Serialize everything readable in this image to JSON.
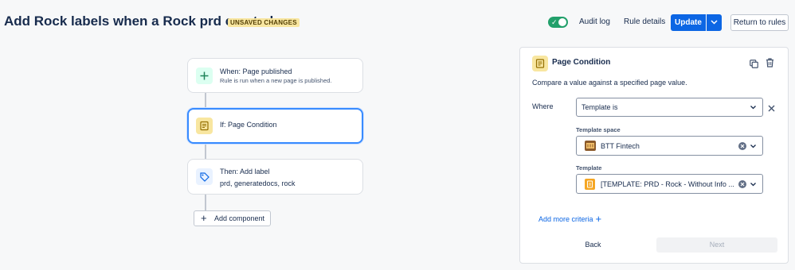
{
  "header": {
    "title": "Add Rock labels when a Rock prd created",
    "badge": "UNSAVED CHANGES",
    "toggle_enabled": true,
    "audit_log": "Audit log",
    "rule_details": "Rule details",
    "update": "Update",
    "return_to_rules": "Return to rules"
  },
  "flow": {
    "trigger": {
      "title": "When: Page published",
      "subtitle": "Rule is run when a new page is published.",
      "icon": "plus-icon"
    },
    "condition": {
      "title": "If: Page Condition",
      "icon": "page-condition-icon"
    },
    "action": {
      "title": "Then: Add label",
      "subtitle": "prd, generatedocs, rock",
      "icon": "tag-icon"
    },
    "add_component": "Add component"
  },
  "panel": {
    "title": "Page Condition",
    "description": "Compare a value against a specified page value.",
    "where_label": "Where",
    "field_select": "Template is",
    "template_space_label": "Template space",
    "template_space_value": "BTT Fintech",
    "template_label": "Template",
    "template_value": "[TEMPLATE: PRD - Rock - Without Info ...",
    "add_more_criteria": "Add more criteria",
    "back": "Back",
    "next": "Next"
  },
  "colors": {
    "primary": "#0c66e4",
    "toggle_on": "#22a06b",
    "badge_bg": "#f8e6a0",
    "trigger_icon_bg": "#dcfff1",
    "condition_icon_bg": "#f8e6a0",
    "action_icon_bg": "#e9f2ff",
    "selected_border": "#388bff"
  }
}
